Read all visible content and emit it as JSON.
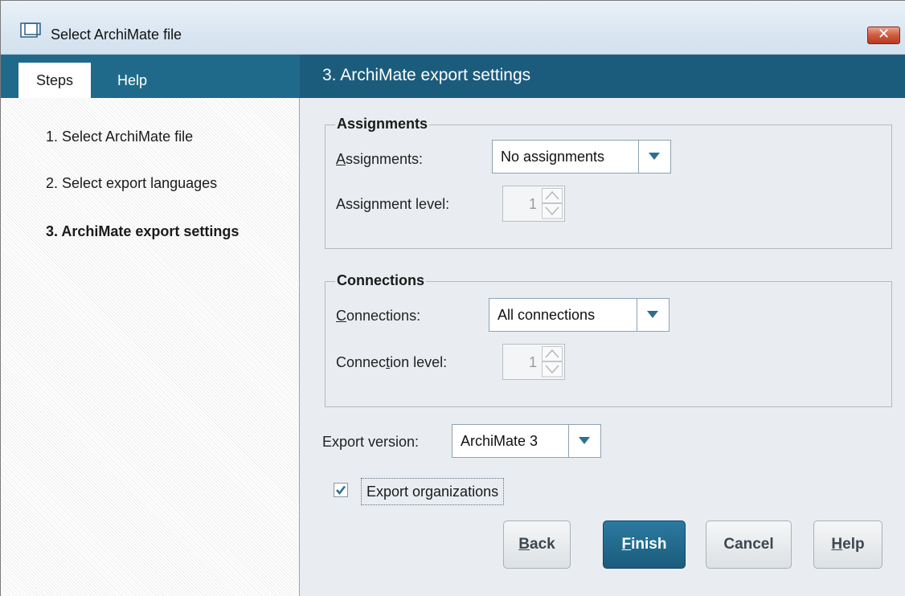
{
  "window": {
    "title": "Select ArchiMate file"
  },
  "left": {
    "tabs": [
      {
        "label": "Steps"
      },
      {
        "label": "Help"
      }
    ],
    "steps": [
      {
        "label": "1. Select ArchiMate file"
      },
      {
        "label": "2. Select export languages"
      },
      {
        "label": "3. ArchiMate export settings"
      }
    ],
    "current_step": 3
  },
  "header": {
    "title": "3. ArchiMate export settings"
  },
  "assignments": {
    "group_title": "Assignments",
    "label_prefix": "A",
    "label_rest": "ssignments:",
    "value": "No assignments",
    "level_label_a": "Assi",
    "level_label_u": "g",
    "level_label_b": "nment level:",
    "level_value": "1"
  },
  "connections": {
    "group_title": "Connections",
    "label_prefix": "C",
    "label_rest": "onnections:",
    "value": "All connections",
    "level_label_a": "Connec",
    "level_label_u": "t",
    "level_label_b": "ion level:",
    "level_value": "1"
  },
  "export_version": {
    "label": "Export version:",
    "value": "ArchiMate 3"
  },
  "export_organizations": {
    "label": "Export organizations",
    "checked": true
  },
  "buttons": {
    "back": {
      "u": "B",
      "rest": "ack"
    },
    "finish": {
      "u": "F",
      "rest": "inish"
    },
    "cancel": {
      "label": "Cancel"
    },
    "help": {
      "u": "H",
      "rest": "elp"
    }
  },
  "colors": {
    "accent": "#1b5c7c",
    "tab_bar": "#1f6a8a",
    "close": "#cf5a3e"
  }
}
